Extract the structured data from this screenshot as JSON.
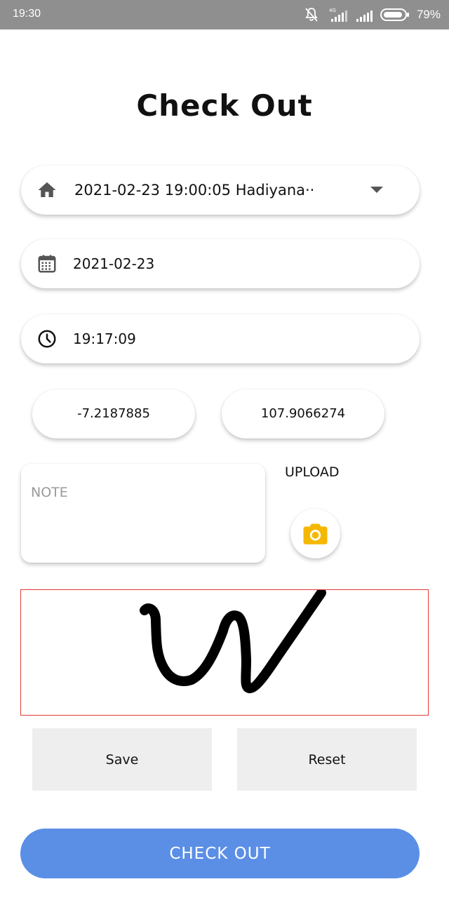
{
  "status_bar": {
    "time": "19:30",
    "battery_percent": "79%",
    "network_label": "4G"
  },
  "page": {
    "title": "Check Out"
  },
  "form": {
    "attendance_select": {
      "value": "2021-02-23 19:00:05 Hadiyana··",
      "icon": "home-icon"
    },
    "date": {
      "value": "2021-02-23",
      "icon": "calendar-icon"
    },
    "time": {
      "value": "19:17:09",
      "icon": "clock-icon"
    },
    "latitude": "-7.2187885",
    "longitude": "107.9066274",
    "note": {
      "placeholder": "NOTE",
      "value": ""
    },
    "upload_label": "UPLOAD"
  },
  "signature": {
    "border_color": "#e53935"
  },
  "buttons": {
    "save": "Save",
    "reset": "Reset",
    "check_out": "CHECK OUT"
  },
  "colors": {
    "accent": "#5b8fe6",
    "camera_icon": "#f5b800",
    "status_bar": "#8f8f8f"
  }
}
